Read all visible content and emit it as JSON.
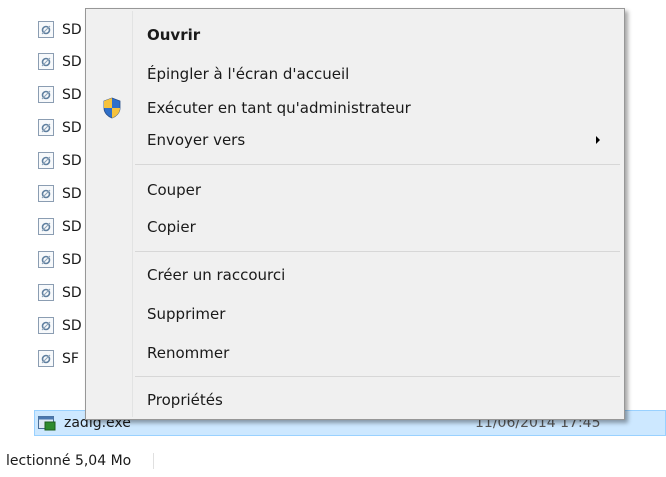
{
  "files": [
    {
      "name": "SD",
      "icon": "file-settings-icon"
    },
    {
      "name": "SD",
      "icon": "file-settings-icon"
    },
    {
      "name": "SD",
      "icon": "file-settings-icon"
    },
    {
      "name": "SD",
      "icon": "file-settings-icon"
    },
    {
      "name": "SD",
      "icon": "file-settings-icon"
    },
    {
      "name": "SD",
      "icon": "file-settings-icon"
    },
    {
      "name": "SD",
      "icon": "file-settings-icon"
    },
    {
      "name": "SD",
      "icon": "file-settings-icon"
    },
    {
      "name": "SD",
      "icon": "file-settings-icon"
    },
    {
      "name": "SD",
      "icon": "file-settings-icon"
    },
    {
      "name": "SF",
      "icon": "file-settings-icon"
    }
  ],
  "selected_file": {
    "name": "zadig.exe",
    "date": "11/06/2014 17:45",
    "icon": "exe-icon"
  },
  "status": {
    "text": "lectionné  5,04 Mo"
  },
  "context_menu": {
    "open": "Ouvrir",
    "pin_start": "Épingler à l'écran d'accueil",
    "run_as_admin": "Exécuter en tant qu'administrateur",
    "send_to": "Envoyer vers",
    "cut": "Couper",
    "copy": "Copier",
    "create_shortcut": "Créer un raccourci",
    "delete": "Supprimer",
    "rename": "Renommer",
    "properties": "Propriétés"
  },
  "colors": {
    "selection_bg": "#cde8ff",
    "selection_border": "#99d1ff",
    "menu_bg": "#f0f0f0"
  }
}
